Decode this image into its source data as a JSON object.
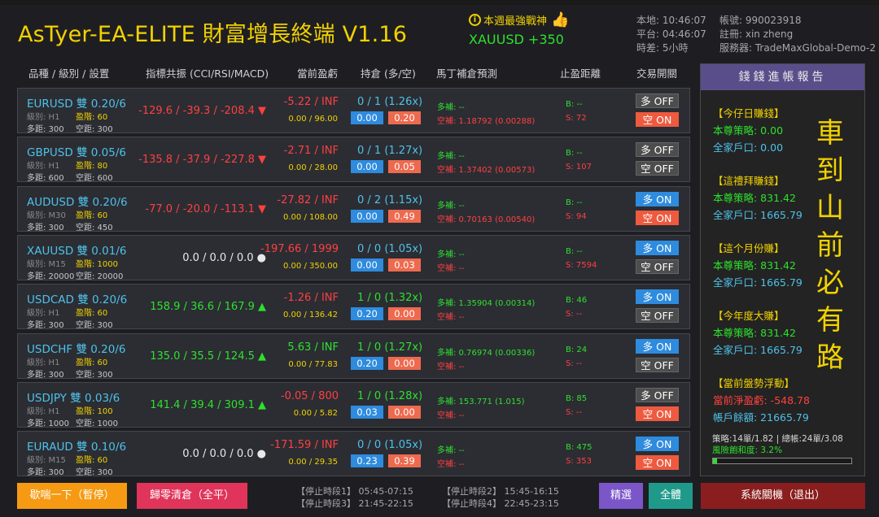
{
  "app": {
    "title": "AsTyer-EA-ELITE 財富增長終端 V1.16"
  },
  "weekly": {
    "label": "本週最強戰神",
    "symbol": "XAUUSD",
    "value": "+350"
  },
  "clock": {
    "local": "本地: 10:46:07",
    "platform": "平台: 04:46:07",
    "diff": "時差: 5小時"
  },
  "account": {
    "number": "帳號: 990023918",
    "name": "註冊: xin zheng",
    "server": "服務器: TradeMaxGlobal-Demo-2"
  },
  "headers": {
    "col1": "品種 / 級別 / 設置",
    "col2": "指標共振 (CCI/RSI/MACD)",
    "col3": "當前盈虧",
    "col4": "持倉 (多/空)",
    "col5": "馬丁補倉預測",
    "col6": "止盈距離",
    "col7": "交易開關"
  },
  "rows": [
    {
      "sym": "EURUSD 雙 0.20/6",
      "lvl": "級別: H1",
      "tp": "盈階: 60",
      "d1": "多距: 300",
      "d2": "空距: 300",
      "ind": "-129.6 / -39.3 / -208.4 ▼",
      "indColor": "red",
      "pl": "-5.22 / INF",
      "plColor": "red",
      "pl2": "0.00 / 96.00",
      "pos": "0 / 1  (1.26x)",
      "posColor": "blue",
      "la": "0.00",
      "lb": "0.20",
      "m1": "多補: --",
      "m2": "空補: 1.18792 (0.00288)",
      "b": "B: --",
      "s": "S: 72",
      "t1": "多 OFF",
      "t1c": "gray",
      "t2": "空 ON",
      "t2c": "red"
    },
    {
      "sym": "GBPUSD 雙 0.05/6",
      "lvl": "級別: H1",
      "tp": "盈階: 80",
      "d1": "多距: 600",
      "d2": "空距: 600",
      "ind": "-135.8 / -37.9 / -227.8 ▼",
      "indColor": "red",
      "pl": "-2.71 / INF",
      "plColor": "red",
      "pl2": "0.00 / 28.00",
      "pos": "0 / 1  (1.27x)",
      "posColor": "blue",
      "la": "0.00",
      "lb": "0.05",
      "m1": "多補: --",
      "m2": "空補: 1.37402 (0.00573)",
      "b": "B: --",
      "s": "S: 107",
      "t1": "多 OFF",
      "t1c": "gray",
      "t2": "空 OFF",
      "t2c": "gray"
    },
    {
      "sym": "AUDUSD 雙 0.20/6",
      "lvl": "級別: M30",
      "tp": "盈階: 60",
      "d1": "多距: 300",
      "d2": "空距: 450",
      "ind": "-77.0 / -20.0 / -113.1 ▼",
      "indColor": "red",
      "pl": "-27.82 / INF",
      "plColor": "red",
      "pl2": "0.00 / 108.00",
      "pos": "0 / 2  (1.15x)",
      "posColor": "blue",
      "la": "0.00",
      "lb": "0.49",
      "m1": "多補: --",
      "m2": "空補: 0.70163 (0.00540)",
      "b": "B: --",
      "s": "S: 94",
      "t1": "多 ON",
      "t1c": "blue",
      "t2": "空 ON",
      "t2c": "red"
    },
    {
      "sym": "XAUUSD 雙 0.01/6",
      "lvl": "級別: M15",
      "tp": "盈階: 1000",
      "d1": "多距: 20000",
      "d2": "空距: 20000",
      "ind": "0.0 / 0.0 / 0.0 ●",
      "indColor": "white",
      "pl": "-197.66 / 1999",
      "plColor": "red",
      "pl2": "0.00 / 350.00",
      "pos": "0 / 0  (1.05x)",
      "posColor": "blue",
      "la": "0.00",
      "lb": "0.03",
      "m1": "多補: --",
      "m2": "空補: --",
      "b": "B: --",
      "s": "S: 7594",
      "t1": "多 ON",
      "t1c": "blue",
      "t2": "空 OFF",
      "t2c": "gray"
    },
    {
      "sym": "USDCAD 雙 0.20/6",
      "lvl": "級別: H1",
      "tp": "盈階: 60",
      "d1": "多距: 300",
      "d2": "空距: 300",
      "ind": "158.9 / 36.6 / 167.9 ▲",
      "indColor": "green",
      "pl": "-1.26 / INF",
      "plColor": "red",
      "pl2": "0.00 / 136.42",
      "pos": "1 / 0  (1.32x)",
      "posColor": "green",
      "la": "0.20",
      "lb": "0.00",
      "m1": "多補: 1.35904 (0.00314)",
      "m2": "空補: --",
      "b": "B: 46",
      "s": "S: --",
      "t1": "多 ON",
      "t1c": "blue",
      "t2": "空 OFF",
      "t2c": "gray"
    },
    {
      "sym": "USDCHF 雙 0.20/6",
      "lvl": "級別: H1",
      "tp": "盈階: 60",
      "d1": "多距: 300",
      "d2": "空距: 300",
      "ind": "135.0 / 35.5 / 124.5 ▲",
      "indColor": "green",
      "pl": "5.63 / INF",
      "plColor": "green",
      "pl2": "0.00 / 77.83",
      "pos": "1 / 0  (1.27x)",
      "posColor": "green",
      "la": "0.20",
      "lb": "0.00",
      "m1": "多補: 0.76974 (0.00336)",
      "m2": "空補: --",
      "b": "B: 24",
      "s": "S: --",
      "t1": "多 ON",
      "t1c": "blue",
      "t2": "空 OFF",
      "t2c": "gray"
    },
    {
      "sym": "USDJPY 雙 0.03/6",
      "lvl": "級別: H1",
      "tp": "盈階: 100",
      "d1": "多距: 1000",
      "d2": "空距: 1000",
      "ind": "141.4 / 39.4 / 309.1 ▲",
      "indColor": "green",
      "pl": "-0.05 / 800",
      "plColor": "red",
      "pl2": "0.00 / 5.82",
      "pos": "1 / 0  (1.28x)",
      "posColor": "green",
      "la": "0.03",
      "lb": "0.00",
      "m1": "多補: 153.771 (1.015)",
      "m2": "空補: --",
      "b": "B: 85",
      "s": "S: --",
      "t1": "多 OFF",
      "t1c": "gray",
      "t2": "空 ON",
      "t2c": "red"
    },
    {
      "sym": "EURAUD 雙 0.10/6",
      "lvl": "級別: M15",
      "tp": "盈階: 60",
      "d1": "多距: 300",
      "d2": "空距: 300",
      "ind": "0.0 / 0.0 / 0.0 ●",
      "indColor": "white",
      "pl": "-171.59 / INF",
      "plColor": "red",
      "pl2": "0.00 / 29.35",
      "pos": "0 / 0  (1.05x)",
      "posColor": "blue",
      "la": "0.23",
      "lb": "0.39",
      "m1": "多補: --",
      "m2": "空補: --",
      "b": "B: 475",
      "s": "S: 353",
      "t1": "多 ON",
      "t1c": "blue",
      "t2": "空 ON",
      "t2c": "red"
    }
  ],
  "side": {
    "title": "錢錢進帳報告",
    "today": {
      "h": "【今仔日賺錢】",
      "a": "本尊策略: 0.00",
      "b": "全家戶口: 0.00"
    },
    "week": {
      "h": "【這禮拜賺錢】",
      "a": "本尊策略: 831.42",
      "b": "全家戶口: 1665.79"
    },
    "month": {
      "h": "【這个月份賺】",
      "a": "本尊策略: 831.42",
      "b": "全家戶口: 1665.79"
    },
    "year": {
      "h": "【今年度大賺】",
      "a": "本尊策略: 831.42",
      "b": "全家戶口: 1665.79"
    },
    "float": {
      "h": "【當前盤勢浮動】",
      "a": "當前淨盈虧: -548.78",
      "b": "帳戶餘額: 21665.79"
    },
    "slogan": [
      "車",
      "到",
      "山",
      "前",
      "必",
      "有",
      "路"
    ],
    "risk1": "策略:14單/1.82 | 總帳:24單/3.08",
    "risk2": "風險飽和度: 3.2%",
    "riskFraction": 0.032
  },
  "footer": {
    "pause": "歇喘一下（暫停）",
    "closeall": "歸零清倉（全平）",
    "stop1": "【停止時段1】 05:45-07:15",
    "stop2": "【停止時段2】 15:45-16:15",
    "stop3": "【停止時段3】 21:45-22:15",
    "stop4": "【停止時段4】 22:45-23:15",
    "select": "精選",
    "all": "全體",
    "exit": "系統關機（退出）"
  }
}
